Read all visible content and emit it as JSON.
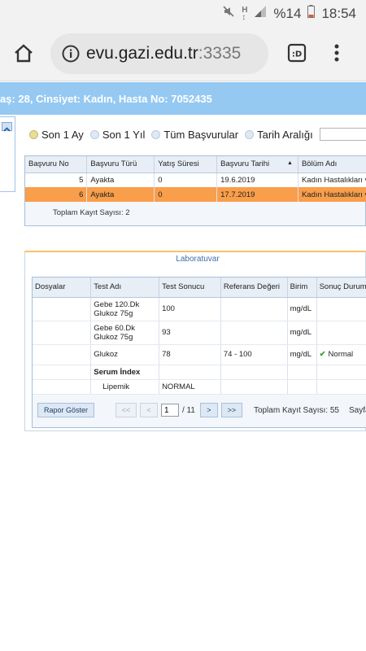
{
  "statusbar": {
    "battery": "%14",
    "time": "18:54"
  },
  "browser": {
    "host": "evu.gazi.edu.tr",
    "port": ":3335"
  },
  "patient_header": "aş: 28, Cinsiyet: Kadın, Hasta No: 7052435",
  "filters": [
    {
      "label": "Son 1 Ay",
      "selected": true
    },
    {
      "label": "Son 1 Yıl",
      "selected": false
    },
    {
      "label": "Tüm Başvurular",
      "selected": false
    },
    {
      "label": "Tarih Aralığı",
      "selected": false
    }
  ],
  "visits": {
    "columns": [
      "Başvuru No",
      "Başvuru Türü",
      "Yatış Süresi",
      "Başvuru Tarihi",
      "Bölüm Adı"
    ],
    "rows": [
      {
        "no": "5",
        "type": "Ayakta",
        "stay": "0",
        "date": "19.6.2019",
        "dept": "Kadın Hastalıkları v",
        "selected": false
      },
      {
        "no": "6",
        "type": "Ayakta",
        "stay": "0",
        "date": "17.7.2019",
        "dept": "Kadın Hastalıkları v",
        "selected": true
      }
    ],
    "footer": "Toplam Kayıt Sayısı: 2"
  },
  "lab": {
    "tab_label": "Laboratuvar",
    "columns": [
      "Dosyalar",
      "Test Adı",
      "Test Sonucu",
      "Referans Değeri",
      "Birim",
      "Sonuç Durumu"
    ],
    "rows": [
      {
        "file": "",
        "test_line1": "Gebe 120.Dk",
        "test_line2": "Glukoz 75g",
        "result": "100",
        "ref": "",
        "unit": "mg/dL",
        "status": ""
      },
      {
        "file": "",
        "test_line1": "Gebe 60.Dk",
        "test_line2": "Glukoz 75g",
        "result": "93",
        "ref": "",
        "unit": "mg/dL",
        "status": ""
      },
      {
        "file": "",
        "test_line1": "Glukoz",
        "test_line2": "",
        "result": "78",
        "ref": "74 - 100",
        "unit": "mg/dL",
        "status": "Normal"
      },
      {
        "file": "",
        "test_line1": "Serum İndex",
        "test_line2": "",
        "result": "",
        "ref": "",
        "unit": "",
        "status": ""
      },
      {
        "file": "",
        "test_line1": "Lipemik",
        "test_line2": "",
        "result": "NORMAL",
        "ref": "",
        "unit": "",
        "status": ""
      }
    ],
    "report_button": "Rapor Göster",
    "pager": {
      "first": "<<",
      "prev": "<",
      "page": "1",
      "total": "/ 11",
      "next": ">",
      "last": ">>"
    },
    "total_records": "Toplam Kayıt Sayısı: 55",
    "page_label": "Sayfada"
  }
}
